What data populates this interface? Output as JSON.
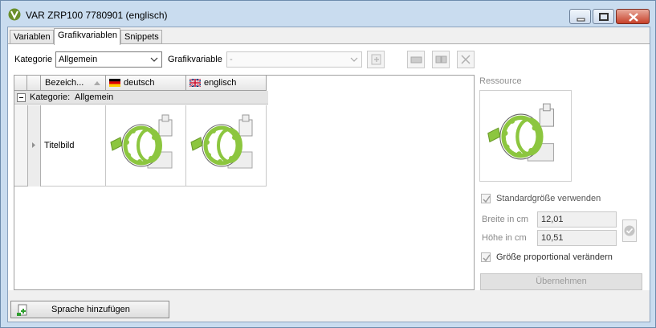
{
  "window": {
    "title": "VAR ZRP100 7780901 (englisch)"
  },
  "tabs": [
    {
      "label": "Variablen",
      "active": false
    },
    {
      "label": "Grafikvariablen",
      "active": true
    },
    {
      "label": "Snippets",
      "active": false
    }
  ],
  "toolbar": {
    "kategorie_label": "Kategorie",
    "kategorie_value": "Allgemein",
    "grafikvariable_label": "Grafikvariable",
    "grafikvariable_value": "-"
  },
  "grid": {
    "columns": [
      "Bezeich...",
      "deutsch",
      "englisch"
    ],
    "group_label": "Kategorie:",
    "group_value": "Allgemein",
    "rows": [
      {
        "name": "Titelbild"
      }
    ]
  },
  "resource": {
    "label": "Ressource",
    "default_size_label": "Standardgröße verwenden",
    "default_size_checked": true,
    "width_label": "Breite in cm",
    "width_value": "12,01",
    "height_label": "Höhe in cm",
    "height_value": "10,51",
    "proportional_label": "Größe proportional verändern",
    "proportional_checked": true,
    "apply_label": "Übernehmen"
  },
  "footer": {
    "add_language_label": "Sprache hinzufügen"
  },
  "colors": {
    "accent_green": "#8cc63f",
    "window_frame": "#c9dcef"
  }
}
